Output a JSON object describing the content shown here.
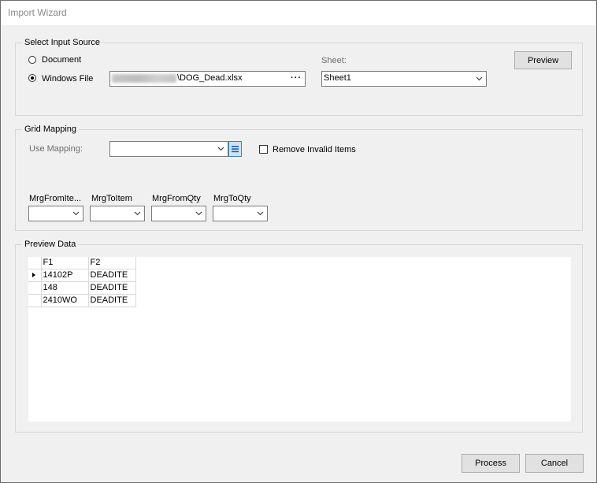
{
  "window": {
    "title": "Import Wizard"
  },
  "input_source": {
    "legend": "Select Input Source",
    "option_document": "Document",
    "option_windows_file": "Windows File",
    "selected": "Windows File",
    "file_path_visible": "\\DOG_Dead.xlsx",
    "browse_label": "···",
    "sheet_label": "Sheet:",
    "sheet_value": "Sheet1",
    "preview_button": "Preview"
  },
  "grid_mapping": {
    "legend": "Grid Mapping",
    "use_mapping_label": "Use Mapping:",
    "use_mapping_value": "",
    "remove_invalid_label": "Remove Invalid Items",
    "remove_invalid_checked": false,
    "columns": [
      {
        "label": "MrgFromIte...",
        "value": ""
      },
      {
        "label": "MrgToItem",
        "value": ""
      },
      {
        "label": "MrgFromQty",
        "value": ""
      },
      {
        "label": "MrgToQty",
        "value": ""
      }
    ]
  },
  "preview_data": {
    "legend": "Preview Data",
    "headers": [
      "F1",
      "F2"
    ],
    "rows": [
      [
        "14102P",
        "DEADITE"
      ],
      [
        "148",
        "DEADITE"
      ],
      [
        "2410WO",
        "DEADITE"
      ]
    ]
  },
  "footer": {
    "process_button": "Process",
    "cancel_button": "Cancel"
  },
  "icons": {
    "chevron": "chevron-down-icon",
    "mapping_list": "list-icon",
    "row_pointer": "row-pointer-icon"
  }
}
